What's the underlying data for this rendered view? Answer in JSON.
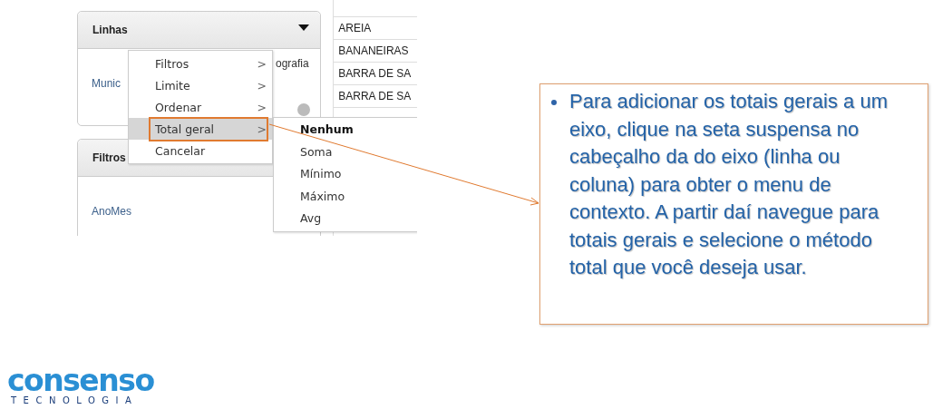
{
  "screenshot": {
    "rows_panel": {
      "title": "Linhas",
      "field": "Munic",
      "field_2": "ografia"
    },
    "filters_panel": {
      "title": "Filtros",
      "field": "AnoMes"
    },
    "table": {
      "rows": [
        "AREIA",
        "BANANEIRAS",
        "BARRA DE SA",
        "BARRA DE SA"
      ]
    },
    "context_menu": {
      "items": [
        {
          "label": "Filtros",
          "arrow": ">",
          "selected": false
        },
        {
          "label": "Limite",
          "arrow": ">",
          "selected": false
        },
        {
          "label": "Ordenar",
          "arrow": ">",
          "selected": false
        },
        {
          "label": "Total geral",
          "arrow": ">",
          "selected": true
        },
        {
          "label": "Cancelar",
          "selected": false
        }
      ]
    },
    "submenu": {
      "items": [
        {
          "label": "Nenhum",
          "selected": true
        },
        {
          "label": "Soma",
          "selected": false
        },
        {
          "label": "Mínimo",
          "selected": false
        },
        {
          "label": "Máximo",
          "selected": false
        },
        {
          "label": "Avg",
          "selected": false
        }
      ]
    }
  },
  "callout": {
    "bullets": [
      "Para adicionar os totais gerais a um eixo, clique na seta suspensa no cabeçalho da do eixo (linha ou coluna) para obter o menu de contexto. A partir daí navegue para totais gerais e selecione  o método total que você deseja usar."
    ]
  },
  "logo": {
    "name": "consenso",
    "tagline": "TECNOLOGIA"
  }
}
